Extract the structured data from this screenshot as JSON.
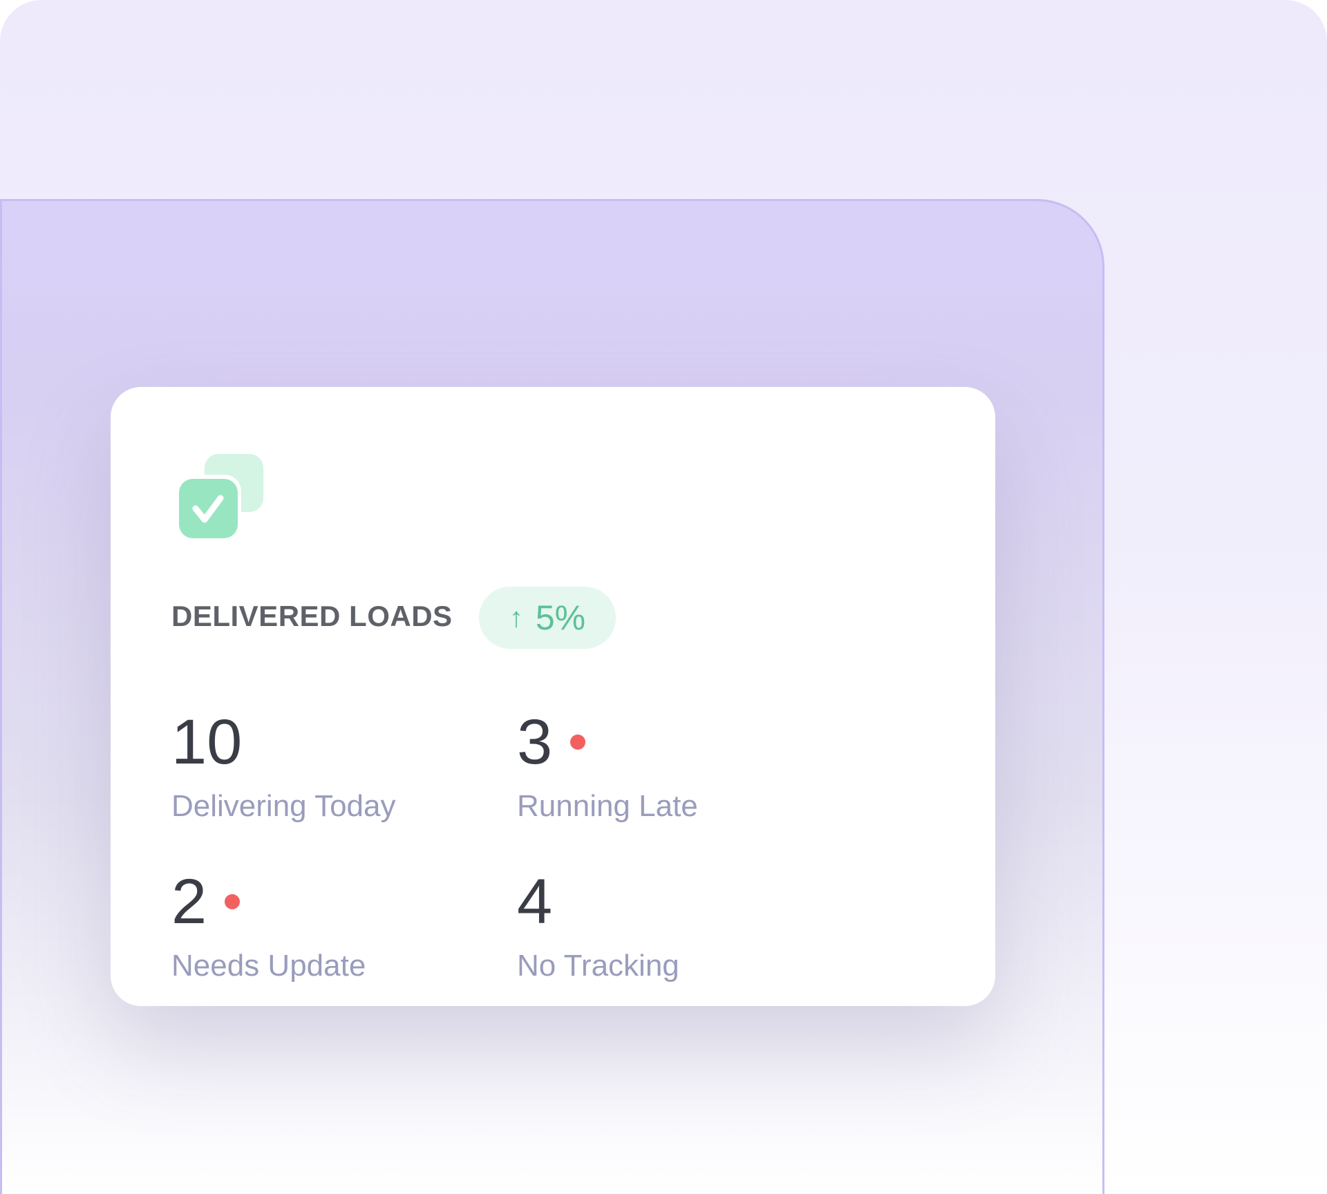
{
  "card": {
    "title": "DELIVERED LOADS",
    "icon": "stacked-check-squares-icon",
    "badge": {
      "arrow": "↑",
      "value": "5%",
      "trend": "up",
      "color": "#5cc09a"
    },
    "stats": [
      {
        "value": "10",
        "label": "Delivering Today",
        "alert": false
      },
      {
        "value": "3",
        "label": "Running Late",
        "alert": true
      },
      {
        "value": "2",
        "label": "Needs Update",
        "alert": true
      },
      {
        "value": "4",
        "label": "No Tracking",
        "alert": false
      }
    ]
  },
  "colors": {
    "alert": "#f26060",
    "accent": "#9a8af0"
  }
}
